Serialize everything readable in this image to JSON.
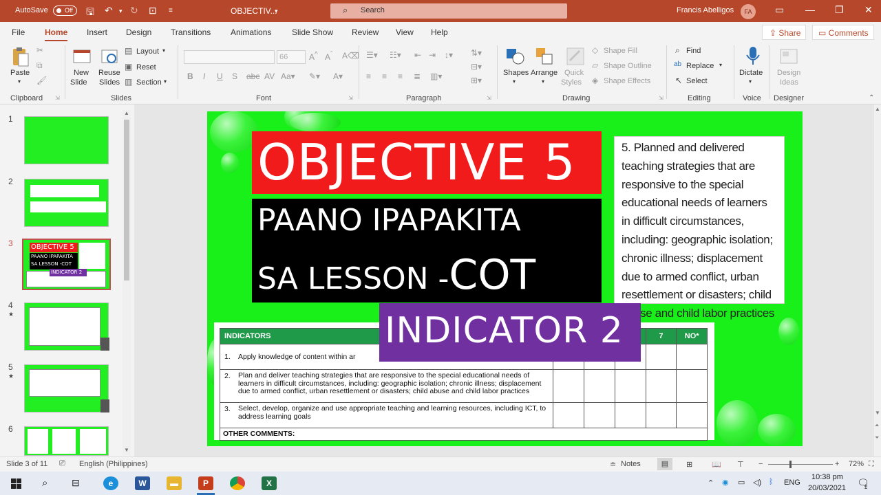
{
  "titlebar": {
    "autosave": "AutoSave",
    "autosave_state": "Off",
    "doc_title": "OBJECTIV...",
    "search_placeholder": "Search",
    "user_name": "Francis Abelligos",
    "user_initials": "FA"
  },
  "menu": {
    "tabs": [
      "File",
      "Home",
      "Insert",
      "Design",
      "Transitions",
      "Animations",
      "Slide Show",
      "Review",
      "View",
      "Help"
    ],
    "share": "Share",
    "comments": "Comments"
  },
  "ribbon": {
    "paste": "Paste",
    "clipboard": "Clipboard",
    "new_slide_1": "New",
    "new_slide_2": "Slide",
    "reuse_1": "Reuse",
    "reuse_2": "Slides",
    "layout": "Layout",
    "reset": "Reset",
    "section": "Section",
    "slides": "Slides",
    "font_size": "66",
    "font": "Font",
    "paragraph": "Paragraph",
    "shapes": "Shapes",
    "arrange": "Arrange",
    "quick_1": "Quick",
    "quick_2": "Styles",
    "shape_fill": "Shape Fill",
    "shape_outline": "Shape Outline",
    "shape_effects": "Shape Effects",
    "drawing": "Drawing",
    "find": "Find",
    "replace": "Replace",
    "select": "Select",
    "editing": "Editing",
    "dictate": "Dictate",
    "voice": "Voice",
    "design_1": "Design",
    "design_2": "Ideas",
    "designer": "Designer"
  },
  "thumbnails": [
    {
      "num": "1",
      "star": ""
    },
    {
      "num": "2",
      "star": ""
    },
    {
      "num": "3",
      "star": "",
      "title": "OBJECTIVE 5",
      "sub1": "PAANO IPAPAKITA",
      "sub2": "SA LESSON -COT",
      "ind": "INDICATOR 2"
    },
    {
      "num": "4",
      "star": "★"
    },
    {
      "num": "5",
      "star": "★"
    },
    {
      "num": "6",
      "star": ""
    }
  ],
  "slide": {
    "title": "OBJECTIVE 5",
    "subtitle_line1": "PAANO IPAPAKITA",
    "subtitle_line2a": "SA LESSON -",
    "subtitle_line2b": "COT",
    "indicator": "INDICATOR 2",
    "description": "5. Planned and delivered teaching strategies that are responsive to the special educational needs of learners in difficult circumstances, including: geographic isolation; chronic illness; displacement due to armed conflict, urban resettlement or disasters; child abuse and child labor practices",
    "table": {
      "header": "INDICATORS",
      "col7": "7",
      "colno": "NO*",
      "rows": [
        {
          "num": "1.",
          "text": "Apply knowledge of content within ar"
        },
        {
          "num": "2.",
          "text": "Plan and deliver teaching strategies that are responsive to the special educational needs of learners in difficult circumstances, including: geographic isolation; chronic illness; displacement due to armed conflict, urban resettlement or disasters; child abuse and child labor practices"
        },
        {
          "num": "3.",
          "text": "Select, develop, organize and use appropriate teaching and learning resources, including ICT, to address learning goals"
        }
      ],
      "comments": "OTHER COMMENTS:"
    }
  },
  "status": {
    "slide_of": "Slide 3 of 11",
    "language": "English (Philippines)",
    "notes": "Notes",
    "zoom": "72%"
  },
  "taskbar": {
    "lang": "ENG",
    "time": "10:38 pm",
    "date": "20/03/2021",
    "notif_count": "2"
  },
  "colors": {
    "accent": "#b7472a",
    "slide_green": "#19f019",
    "title_red": "#f21b1b",
    "indicator_purple": "#7030a0",
    "table_header_green": "#1f9a48"
  }
}
